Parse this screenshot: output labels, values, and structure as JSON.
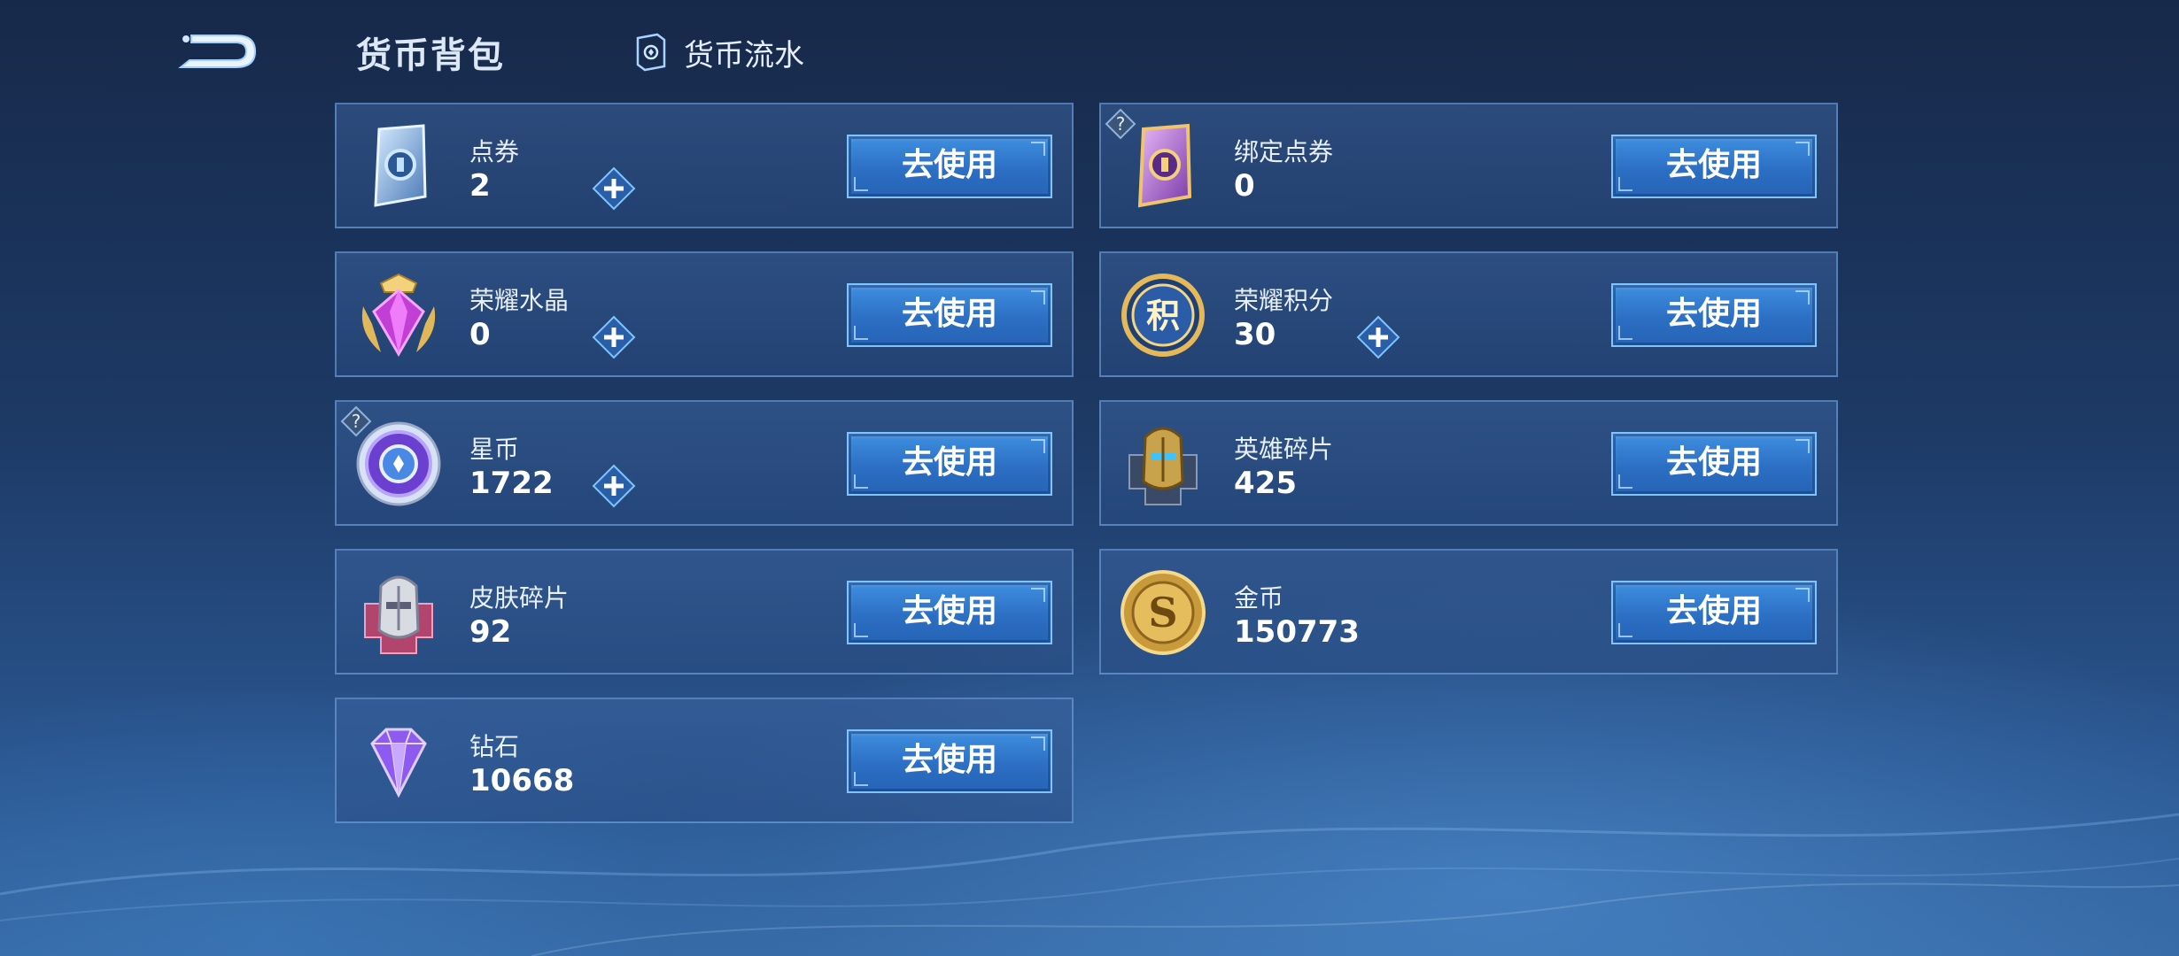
{
  "header": {
    "title": "货币背包",
    "history_label": "货币流水",
    "back_icon": "back-arrow-icon",
    "history_icon": "ledger-icon"
  },
  "use_label": "去使用",
  "currencies": [
    {
      "name": "点券",
      "value": "2",
      "icon": "voucher-blue-icon",
      "has_plus": true,
      "has_help": false
    },
    {
      "name": "绑定点券",
      "value": "0",
      "icon": "voucher-purple-icon",
      "has_plus": false,
      "has_help": true
    },
    {
      "name": "荣耀水晶",
      "value": "0",
      "icon": "glory-crystal-icon",
      "has_plus": true,
      "has_help": false
    },
    {
      "name": "荣耀积分",
      "value": "30",
      "icon": "glory-points-icon",
      "has_plus": true,
      "has_help": false
    },
    {
      "name": "星币",
      "value": "1722",
      "icon": "star-coin-icon",
      "has_plus": true,
      "has_help": true
    },
    {
      "name": "英雄碎片",
      "value": "425",
      "icon": "hero-fragment-icon",
      "has_plus": false,
      "has_help": false
    },
    {
      "name": "皮肤碎片",
      "value": "92",
      "icon": "skin-fragment-icon",
      "has_plus": false,
      "has_help": false
    },
    {
      "name": "金币",
      "value": "150773",
      "icon": "gold-coin-icon",
      "has_plus": false,
      "has_help": false
    },
    {
      "name": "钻石",
      "value": "10668",
      "icon": "diamond-icon",
      "has_plus": false,
      "has_help": false
    }
  ],
  "colors": {
    "button": "#2c6fc4",
    "button_border": "#7ec4ff",
    "card_border": "#78aae6"
  }
}
